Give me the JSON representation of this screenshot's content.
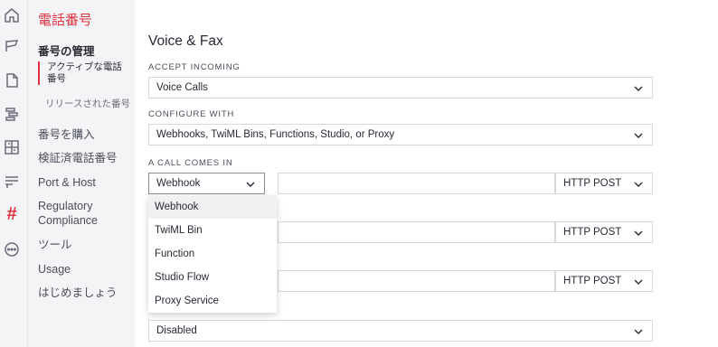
{
  "rail": {
    "icons": [
      {
        "name": "home-icon"
      },
      {
        "name": "flag-icon"
      },
      {
        "name": "document-icon"
      },
      {
        "name": "flow-icon"
      },
      {
        "name": "network-icon"
      },
      {
        "name": "chat-icon"
      },
      {
        "name": "hash-icon",
        "glyph": "#"
      },
      {
        "name": "more-icon"
      }
    ]
  },
  "sidebar": {
    "title": "電話番号",
    "section": "番号の管理",
    "sub_active": "アクティブな電話番号",
    "sub_released": "リリースされた番号",
    "items": [
      {
        "label": "番号を購入"
      },
      {
        "label": "検証済電話番号"
      },
      {
        "label": "Port & Host"
      },
      {
        "label": "Regulatory Compliance"
      },
      {
        "label": "ツール"
      },
      {
        "label": "Usage"
      },
      {
        "label": "はじめましょう"
      }
    ]
  },
  "main": {
    "title": "Voice & Fax",
    "accept_incoming": {
      "label": "ACCEPT INCOMING",
      "value": "Voice Calls"
    },
    "configure_with": {
      "label": "CONFIGURE WITH",
      "value": "Webhooks, TwiML Bins, Functions, Studio, or Proxy"
    },
    "call_comes_in": {
      "label": "A CALL COMES IN",
      "type_value": "Webhook",
      "url_value": "",
      "method": "HTTP POST"
    },
    "row2": {
      "method": "HTTP POST"
    },
    "row3": {
      "method": "HTTP POST"
    },
    "bottom_select": {
      "value": "Disabled"
    }
  },
  "dropdown": {
    "options": [
      "Webhook",
      "TwiML Bin",
      "Function",
      "Studio Flow",
      "Proxy Service"
    ],
    "highlighted": "Webhook"
  }
}
